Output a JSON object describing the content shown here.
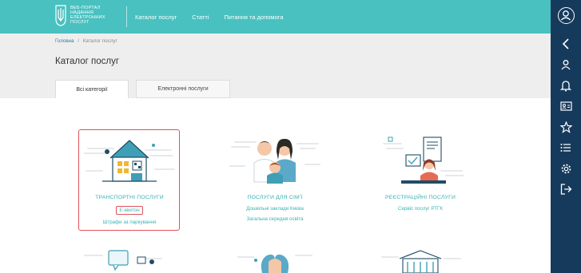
{
  "header": {
    "logo_text": "ВЕБ-ПОРТАЛ НАДАННЯ ЕЛЕКТРОННИХ ПОСЛУГ",
    "nav": [
      "Каталог послуг",
      "Статті",
      "Питання та допомога"
    ]
  },
  "breadcrumb": {
    "home": "Головна",
    "separator": "/",
    "current": "Каталог послуг"
  },
  "page_title": "Каталог послуг",
  "tabs": [
    {
      "label": "Всі категорії",
      "active": true
    },
    {
      "label": "Електронні послуги",
      "active": false
    }
  ],
  "categories": [
    {
      "title": "ТРАНСПОРТНІ ПОСЛУГИ",
      "links": [
        "Е-квитон",
        "Штрафи за паркування"
      ],
      "highlighted": true
    },
    {
      "title": "ПОСЛУГИ ДЛЯ СІМ'Ї",
      "links": [
        "Дошкільні заклади Києва",
        "Загальна середня освіта"
      ]
    },
    {
      "title": "РЕЄСТРАЦІЙНІ ПОСЛУГИ",
      "links": [
        "Сервіс послуг РТГК"
      ]
    }
  ],
  "sidebar_icons": [
    "user-avatar-icon",
    "collapse-arrow-icon",
    "profile-icon",
    "notifications-icon",
    "id-card-icon",
    "favorites-star-icon",
    "list-icon",
    "settings-gear-icon",
    "logout-icon"
  ],
  "colors": {
    "header": "#49c1c0",
    "sidebar": "#163a5c",
    "accent_text": "#39b0b0",
    "highlight": "#e0505a"
  }
}
